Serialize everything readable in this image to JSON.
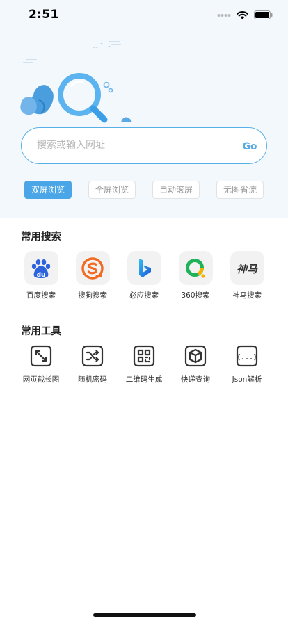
{
  "status_bar": {
    "time": "2:51"
  },
  "search": {
    "placeholder": "搜索或输入网址",
    "go_label": "Go"
  },
  "browse_modes": [
    {
      "label": "双屏浏览",
      "active": true
    },
    {
      "label": "全屏浏览",
      "active": false
    },
    {
      "label": "自动滚屏",
      "active": false
    },
    {
      "label": "无图省流",
      "active": false
    }
  ],
  "common_search": {
    "title": "常用搜索",
    "engines": [
      {
        "label": "百度搜索",
        "icon": "baidu-icon",
        "logo_text": "du"
      },
      {
        "label": "搜狗搜索",
        "icon": "sogou-icon"
      },
      {
        "label": "必应搜索",
        "icon": "bing-icon"
      },
      {
        "label": "360搜索",
        "icon": "360-icon"
      },
      {
        "label": "神马搜索",
        "icon": "shenma-icon",
        "logo_text": "神马"
      }
    ]
  },
  "common_tools": {
    "title": "常用工具",
    "tools": [
      {
        "label": "网页截长图",
        "icon": "expand-icon"
      },
      {
        "label": "随机密码",
        "icon": "shuffle-icon"
      },
      {
        "label": "二维码生成",
        "icon": "qrcode-icon"
      },
      {
        "label": "快递查询",
        "icon": "package-icon"
      },
      {
        "label": "Json解析",
        "icon": "json-braces-icon",
        "icon_text": "{...}"
      }
    ]
  },
  "colors": {
    "accent": "#4aa6e6",
    "hero_background": "#f3f8fc",
    "search_border": "#58b0e8"
  }
}
